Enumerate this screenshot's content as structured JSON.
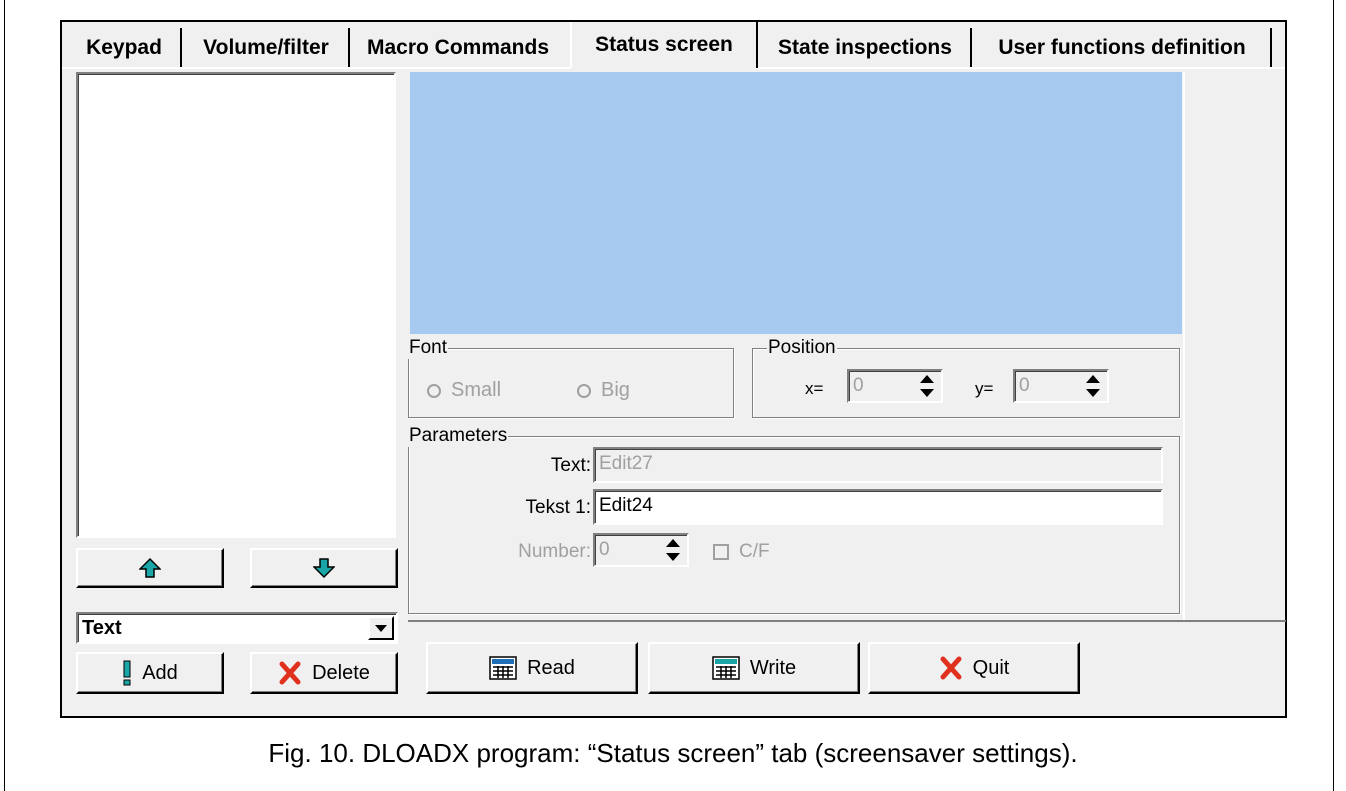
{
  "tabs": [
    {
      "label": "Keypad"
    },
    {
      "label": "Volume/filter"
    },
    {
      "label": "Macro Commands"
    },
    {
      "label": "Status screen",
      "active": true
    },
    {
      "label": "State inspections"
    },
    {
      "label": "User functions definition"
    }
  ],
  "left_panel": {
    "type_select": {
      "value": "Text"
    },
    "add_label": "Add",
    "delete_label": "Delete"
  },
  "font_group": {
    "title": "Font",
    "options": [
      "Small",
      "Big"
    ]
  },
  "position_group": {
    "title": "Position",
    "x_label": "x=",
    "x_value": "0",
    "y_label": "y=",
    "y_value": "0"
  },
  "parameters_group": {
    "title": "Parameters",
    "text_label": "Text:",
    "text_value": "Edit27",
    "tekst1_label": "Tekst 1:",
    "tekst1_value": "Edit24",
    "number_label": "Number:",
    "number_value": "0",
    "cf_label": "C/F"
  },
  "actions": {
    "read_label": "Read",
    "write_label": "Write",
    "quit_label": "Quit"
  },
  "caption": "Fig. 10. DLOADX program: “Status screen” tab (screensaver settings).",
  "colors": {
    "preview_bg": "#a6c9ef",
    "window_bg": "#f0f0f0",
    "arrow_cyan": "#1aa6a6",
    "delete_red": "#e0301e"
  }
}
